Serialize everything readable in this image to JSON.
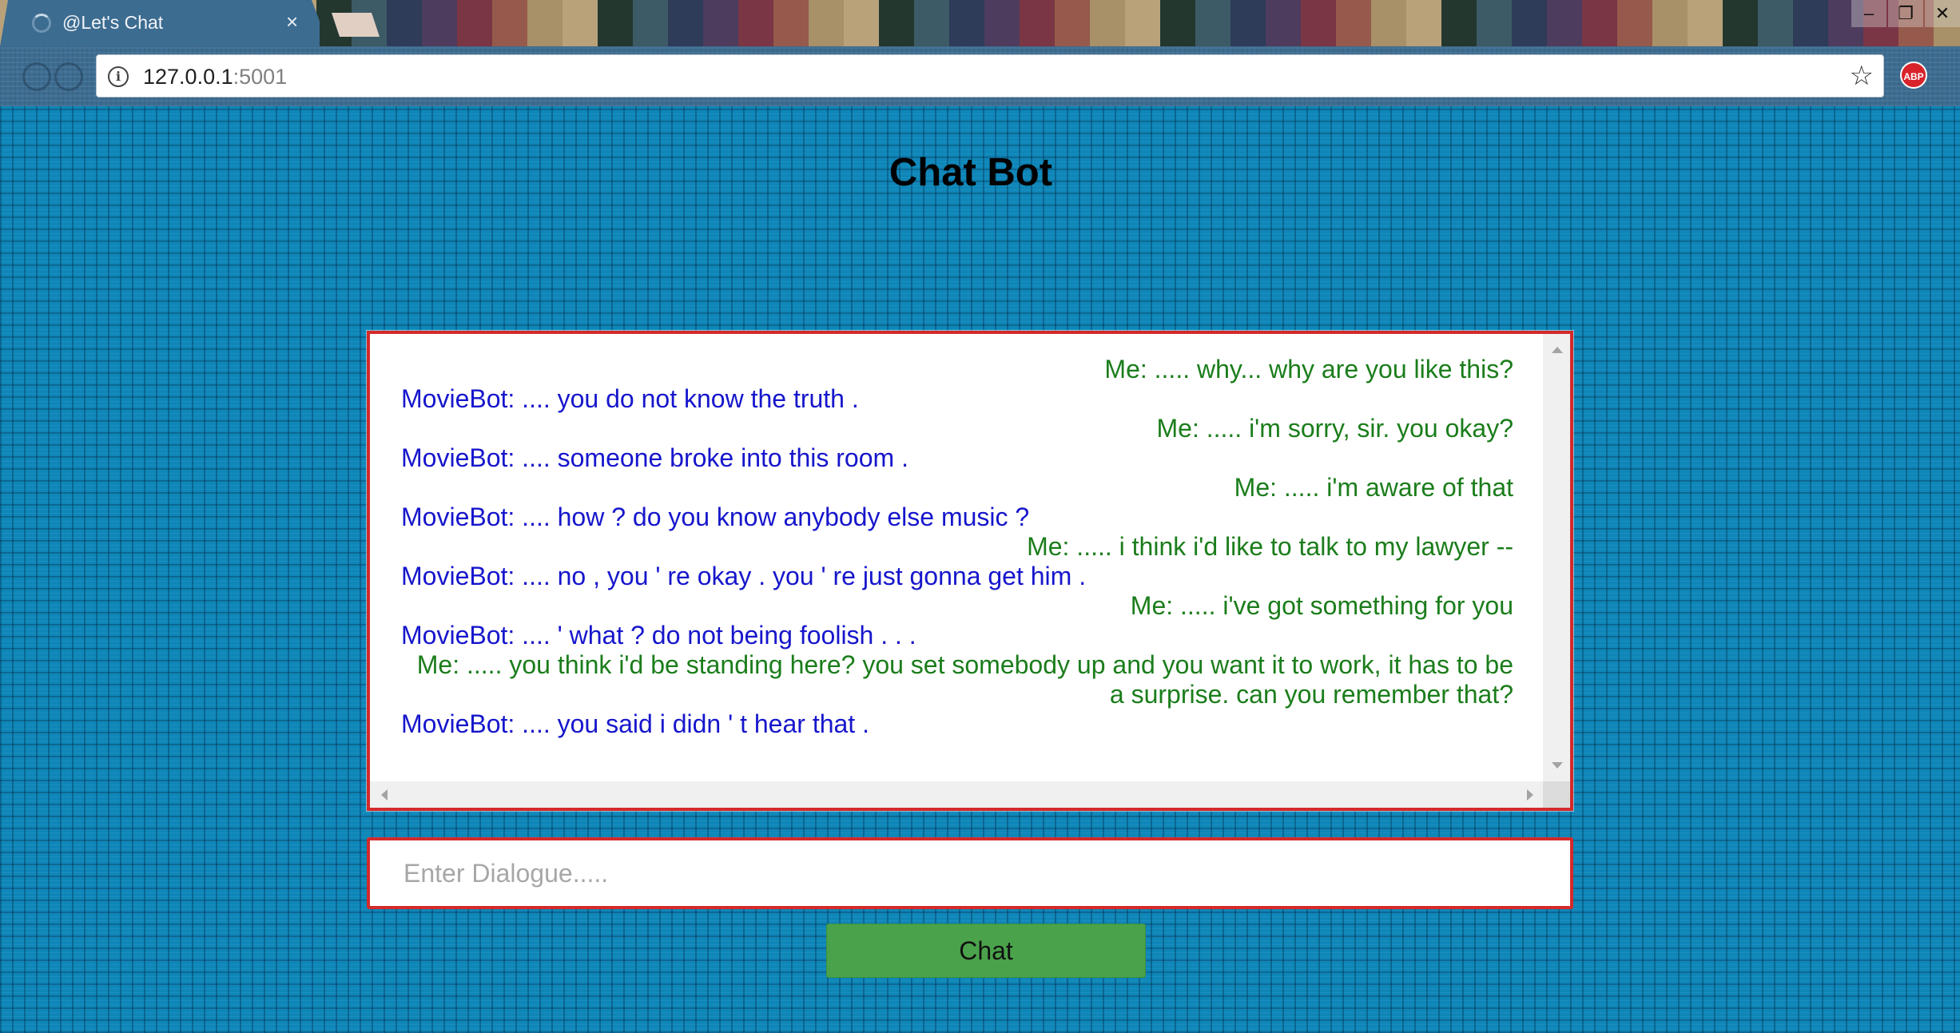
{
  "browser": {
    "tab_title": "@Let's Chat",
    "tab_close_glyph": "×",
    "url_host": "127.0.0.1",
    "url_port": ":5001",
    "info_glyph": "i",
    "star_glyph": "☆",
    "adblock_label": "ABP",
    "window_controls": {
      "minimize": "–",
      "restore": "❐",
      "close": "✕"
    }
  },
  "page": {
    "title": "Chat Bot"
  },
  "chat": {
    "messages": [
      {
        "sender": "me",
        "text": "Me: ..... why... why are you like this?"
      },
      {
        "sender": "bot",
        "text": "MovieBot: .... you do not know the truth ."
      },
      {
        "sender": "me",
        "text": "Me: ..... i'm sorry, sir. you okay?"
      },
      {
        "sender": "bot",
        "text": "MovieBot: .... someone broke into this room ."
      },
      {
        "sender": "me",
        "text": "Me: ..... i'm aware of that"
      },
      {
        "sender": "bot",
        "text": "MovieBot: .... how ? do you know anybody else music ?"
      },
      {
        "sender": "me",
        "text": "Me: ..... i think i'd like to talk to my lawyer --"
      },
      {
        "sender": "bot",
        "text": "MovieBot: .... no , you ' re okay . you ' re just gonna get him ."
      },
      {
        "sender": "me",
        "text": "Me: ..... i've got something for you"
      },
      {
        "sender": "bot",
        "text": "MovieBot: .... ' what ? do not being foolish . . ."
      },
      {
        "sender": "me",
        "text": "Me: ..... you think i'd be standing here? you set somebody up and you want it to work, it has to be a surprise. can you remember that?"
      },
      {
        "sender": "bot",
        "text": "MovieBot: .... you said i didn ' t hear that ."
      }
    ]
  },
  "input": {
    "placeholder": "Enter Dialogue.....",
    "value": ""
  },
  "chat_button": {
    "label": "Chat"
  },
  "colors": {
    "me_text": "#1b7d1b",
    "bot_text": "#1616cc",
    "border_red": "#d42a2a",
    "button_green": "#4aa34a",
    "page_background": "#0f86b8"
  },
  "icons": [
    "loading-spinner-icon",
    "close-icon",
    "info-icon",
    "star-icon",
    "adblock-icon",
    "minimize-icon",
    "restore-icon",
    "window-close-icon"
  ]
}
